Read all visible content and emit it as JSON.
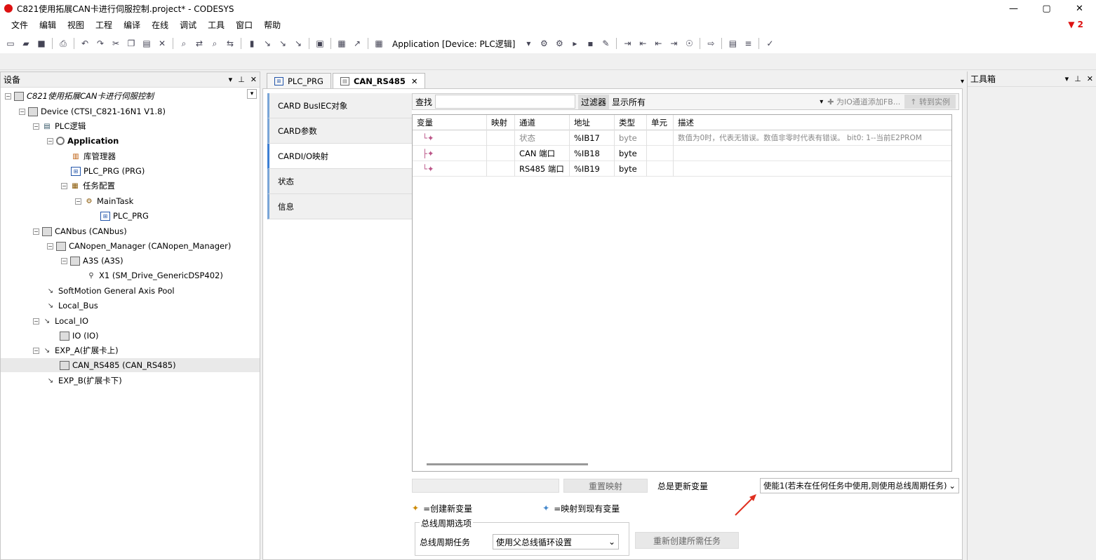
{
  "window": {
    "title": "C821使用拓展CAN卡进行伺服控制.project* - CODESYS",
    "minimize": "—",
    "maximize": "▢",
    "close": "✕",
    "alert_count": "2"
  },
  "menu": [
    "文件",
    "编辑",
    "视图",
    "工程",
    "编译",
    "在线",
    "调试",
    "工具",
    "窗口",
    "帮助"
  ],
  "toolbar": {
    "app_selector": "Application [Device: PLC逻辑]"
  },
  "devices_panel": {
    "title": "设备",
    "tree": [
      {
        "label": "C821使用拓展CAN卡进行伺服控制",
        "icon": "project-icon"
      },
      {
        "label": "Device (CTSI_C821-16N1 V1.8)",
        "icon": "device-icon"
      },
      {
        "label": "PLC逻辑",
        "icon": "plc-logic-icon"
      },
      {
        "label": "Application",
        "icon": "gear-icon"
      },
      {
        "label": "库管理器",
        "icon": "library-icon"
      },
      {
        "label": "PLC_PRG (PRG)",
        "icon": "program-icon"
      },
      {
        "label": "任务配置",
        "icon": "task-config-icon"
      },
      {
        "label": "MainTask",
        "icon": "task-icon"
      },
      {
        "label": "PLC_PRG",
        "icon": "program-call-icon"
      },
      {
        "label": "CANbus (CANbus)",
        "icon": "device-icon"
      },
      {
        "label": "CANopen_Manager (CANopen_Manager)",
        "icon": "device-icon"
      },
      {
        "label": "A3S (A3S)",
        "icon": "device-icon"
      },
      {
        "label": "X1 (SM_Drive_GenericDSP402)",
        "icon": "drive-icon"
      },
      {
        "label": "SoftMotion General Axis Pool",
        "icon": "axis-icon"
      },
      {
        "label": "Local_Bus",
        "icon": "axis-icon"
      },
      {
        "label": "Local_IO",
        "icon": "axis-icon"
      },
      {
        "label": "IO (IO)",
        "icon": "device-icon"
      },
      {
        "label": "EXP_A(扩展卡上)",
        "icon": "axis-icon"
      },
      {
        "label": "CAN_RS485 (CAN_RS485)",
        "icon": "device-icon"
      },
      {
        "label": "EXP_B(扩展卡下)",
        "icon": "axis-icon"
      }
    ]
  },
  "editor_tabs": [
    {
      "label": "PLC_PRG"
    },
    {
      "label": "CAN_RS485"
    }
  ],
  "vertical_tabs": [
    "CARD BusIEC对象",
    "CARD参数",
    "CARDI/O映射",
    "状态",
    "信息"
  ],
  "find": {
    "label": "查找",
    "filter_label": "过滤器",
    "filter_value": "显示所有",
    "add_fb": "为IO通道添加FB...",
    "goto_instance": "转到实例"
  },
  "grid": {
    "headers": [
      "变量",
      "映射",
      "通道",
      "地址",
      "类型",
      "单元",
      "描述"
    ],
    "rows": [
      {
        "channel": "状态",
        "address": "%IB17",
        "type": "byte",
        "desc": "数值为0时，代表无错误。数值非零时代表有错误。 bit0: 1--当前E2PROM"
      },
      {
        "channel": "CAN 端口",
        "address": "%IB18",
        "type": "byte",
        "desc": ""
      },
      {
        "channel": "RS485 端口",
        "address": "%IB19",
        "type": "byte",
        "desc": ""
      }
    ]
  },
  "bottom": {
    "reset_mapping": "重置映射",
    "always_update": "总是更新变量",
    "update_option": "使能1(若未在任何任务中使用,则使用总线周期任务)"
  },
  "legend": {
    "create_new": "=创建新变量",
    "map_existing": "=映射到现有变量"
  },
  "bus_cycle": {
    "group_label": "总线周期选项",
    "task_label": "总线周期任务",
    "task_value": "使用父总线循环设置",
    "recreate": "重新创建所需任务"
  },
  "toolbox": {
    "title": "工具箱"
  }
}
